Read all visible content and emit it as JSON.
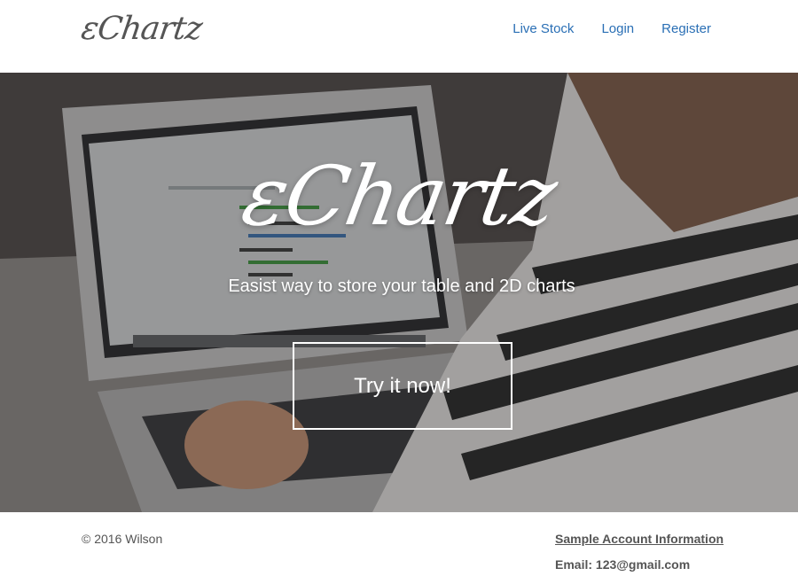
{
  "header": {
    "logo_text": "εChartz",
    "nav": [
      {
        "label": "Live Stock"
      },
      {
        "label": "Login"
      },
      {
        "label": "Register"
      }
    ]
  },
  "hero": {
    "title": "εChartz",
    "subtitle": "Easist way to store your table and 2D charts",
    "cta_label": "Try it now!"
  },
  "footer": {
    "copyright": "© 2016 Wilson",
    "sample_title": "Sample Account Information",
    "sample_email": "Email: 123@gmail.com"
  }
}
